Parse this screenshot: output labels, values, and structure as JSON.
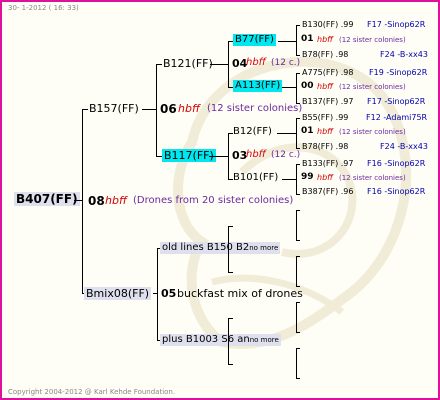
{
  "header": {
    "date": "30-  1-2012 ( 16: 33)"
  },
  "footer": {
    "copyright": "Copyright 2004-2012 @ Karl Kehde Foundation."
  },
  "root": {
    "label": "B407(FF)"
  },
  "gen1": {
    "top": {
      "label": "B157(FF)"
    },
    "mid": {
      "num": "08",
      "code": "hbff",
      "note": "(Drones from 20 sister colonies)"
    },
    "bottom": {
      "label": "Bmix08(FF)"
    }
  },
  "gen2": {
    "a": {
      "label": "B121(FF)"
    },
    "mid1": {
      "num": "06",
      "code": "hbff",
      "note": "(12 sister colonies)"
    },
    "b": {
      "label": "B117(FF)"
    },
    "c": {
      "label": "old lines B150 B2",
      "suffix": "no more"
    },
    "mid2": {
      "num": "05",
      "text": "buckfast mix of drones"
    },
    "d": {
      "label": "plus B1003 S6 an",
      "suffix": "no more"
    }
  },
  "gen3": {
    "a": {
      "label": "B77(FF)"
    },
    "amid": {
      "num": "04",
      "code": "hbff",
      "note": "(12 c.)"
    },
    "b": {
      "label": "A113(FF)"
    },
    "c": {
      "label": "B12(FF)"
    },
    "cmid": {
      "num": "03",
      "code": "hbff",
      "note": "(12 c.)"
    },
    "d": {
      "label": "B101(FF)"
    }
  },
  "gen4": [
    {
      "name": "B130(FF)",
      "val": ".99",
      "src": "F17 -Sinop62R"
    },
    {
      "num": "01",
      "code": "hbff",
      "note": "(12 sister colonies)"
    },
    {
      "name": "B78(FF)",
      "val": ".98",
      "src": "F24 -B-xx43"
    },
    {
      "name": "A775(FF)",
      "val": ".98",
      "src": "F19 -Sinop62R"
    },
    {
      "num": "00",
      "code": "hbff",
      "note": "(12 sister colonies)"
    },
    {
      "name": "B137(FF)",
      "val": ".97",
      "src": "F17 -Sinop62R"
    },
    {
      "name": "B55(FF)",
      "val": ".99",
      "src": "F12 -Adami75R"
    },
    {
      "num": "01",
      "code": "hbff",
      "note": "(12 sister colonies)"
    },
    {
      "name": "B78(FF)",
      "val": ".98",
      "src": "F24 -B-xx43"
    },
    {
      "name": "B133(FF)",
      "val": ".97",
      "src": "F16 -Sinop62R"
    },
    {
      "num": "99",
      "code": "hbff",
      "note": "(12 sister colonies)"
    },
    {
      "name": "B387(FF)",
      "val": ".96",
      "src": "F16 -Sinop62R"
    }
  ]
}
